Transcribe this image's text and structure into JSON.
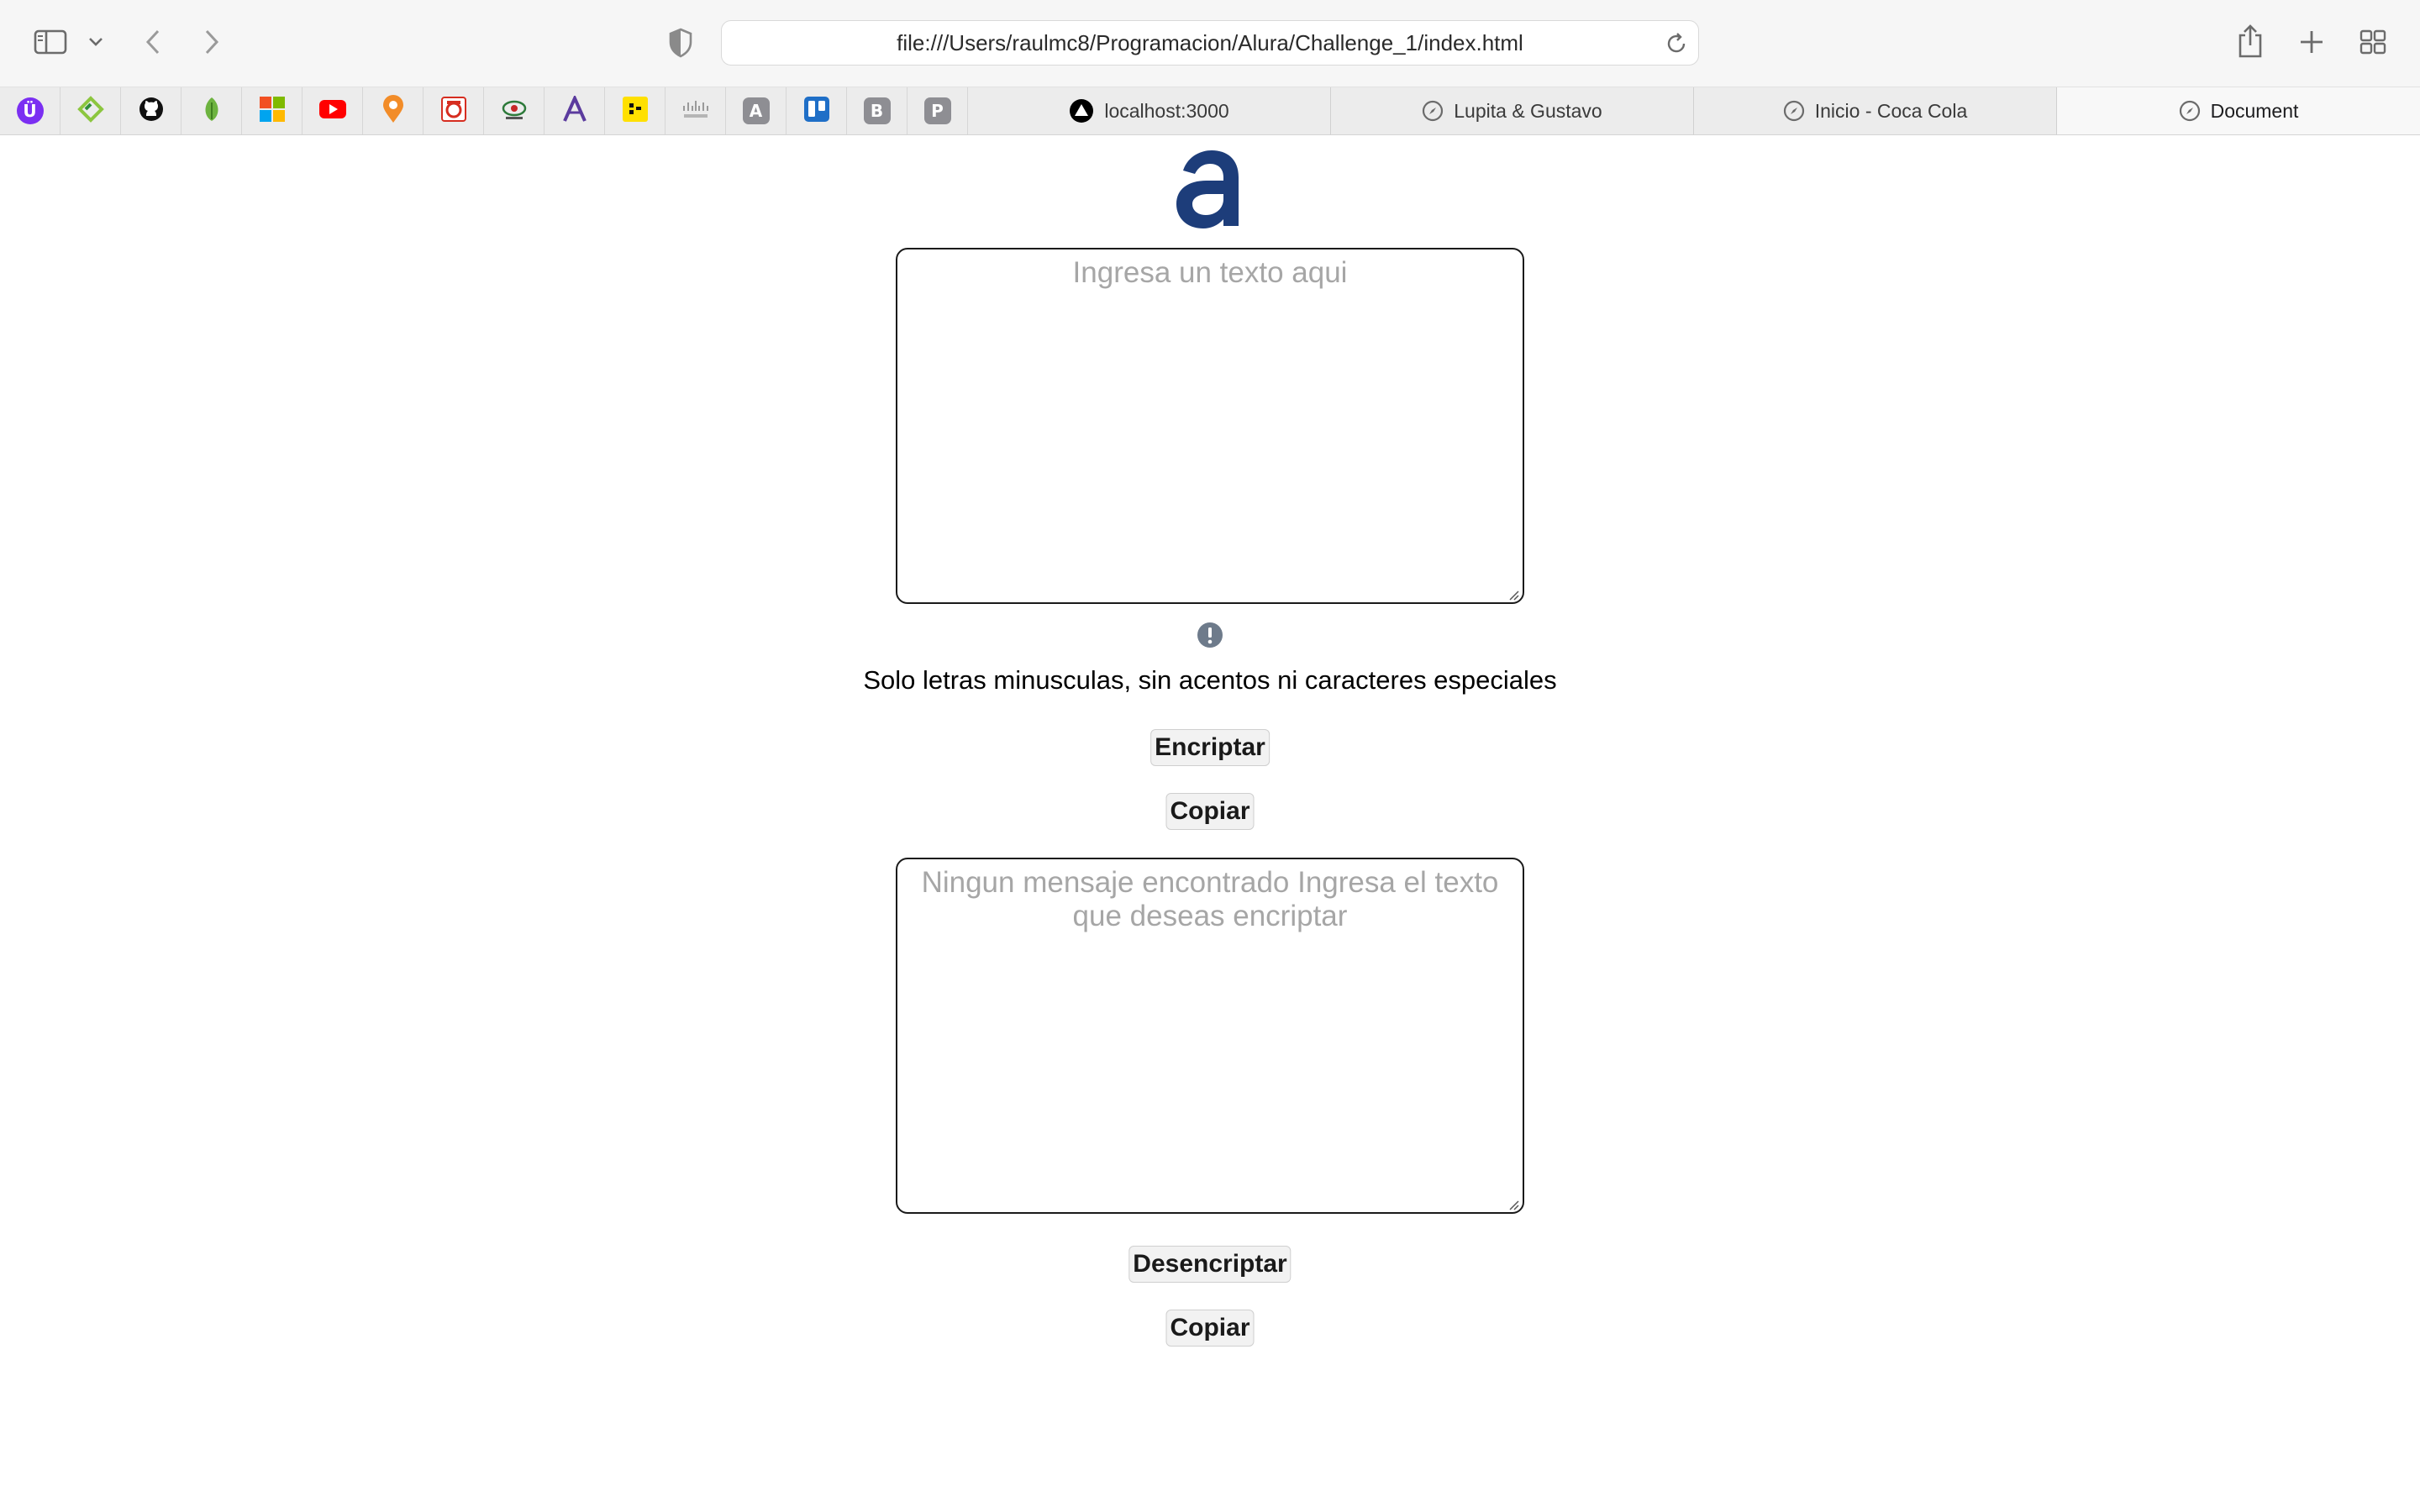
{
  "browser": {
    "url": "file:///Users/raulmc8/Programacion/Alura/Challenge_1/index.html",
    "bookmarks": [
      {
        "icon": "ublock-icon",
        "letter": "Ü",
        "color": "#7b2ff2"
      },
      {
        "icon": "diamond-bookmark-icon",
        "letter": "",
        "color": "#8cc63f"
      },
      {
        "icon": "github-icon",
        "letter": "",
        "color": "#111111"
      },
      {
        "icon": "leaf-icon",
        "letter": "",
        "color": "#6db33f"
      },
      {
        "icon": "microsoft-icon",
        "letter": "",
        "color": "#f25022"
      },
      {
        "icon": "youtube-icon",
        "letter": "",
        "color": "#ff0000"
      },
      {
        "icon": "pin-icon",
        "letter": "",
        "color": "#f28c28"
      },
      {
        "icon": "red-bookmark-icon",
        "letter": "",
        "color": "#d62d20"
      },
      {
        "icon": "eye-bookmark-icon",
        "letter": "",
        "color": "#2d7a3a"
      },
      {
        "icon": "letter-a-icon",
        "letter": "A",
        "color": "#5b3b9e"
      },
      {
        "icon": "yellow-bookmark-icon",
        "letter": "",
        "color": "#ffe000"
      },
      {
        "icon": "cisco-icon",
        "letter": "",
        "color": "#9a9a9a"
      },
      {
        "icon": "letter-a-gray-icon",
        "letter": "A",
        "color": "#8e8e93"
      },
      {
        "icon": "trello-icon",
        "letter": "",
        "color": "#1f6fc7"
      },
      {
        "icon": "letter-b-icon",
        "letter": "B",
        "color": "#8e8e93"
      },
      {
        "icon": "letter-p-icon",
        "letter": "P",
        "color": "#8e8e93"
      }
    ],
    "tabs": [
      {
        "label": "localhost:3000",
        "icon": "triangle-icon",
        "active": false
      },
      {
        "label": "Lupita & Gustavo",
        "icon": "compass-icon",
        "active": false
      },
      {
        "label": "Inicio - Coca Cola",
        "icon": "compass-icon",
        "active": false
      },
      {
        "label": "Document",
        "icon": "compass-icon",
        "active": true
      }
    ]
  },
  "app": {
    "logo_letter": "a",
    "logo_color": "#1d3d7a",
    "input": {
      "placeholder": "Ingresa un texto aqui",
      "value": ""
    },
    "hint": "Solo letras minusculas, sin acentos ni caracteres especiales",
    "encrypt_label": "Encriptar",
    "copy_label_1": "Copiar",
    "output": {
      "placeholder": "Ningun mensaje encontrado Ingresa el texto que deseas encriptar",
      "value": ""
    },
    "decrypt_label": "Desencriptar",
    "copy_label_2": "Copiar"
  }
}
